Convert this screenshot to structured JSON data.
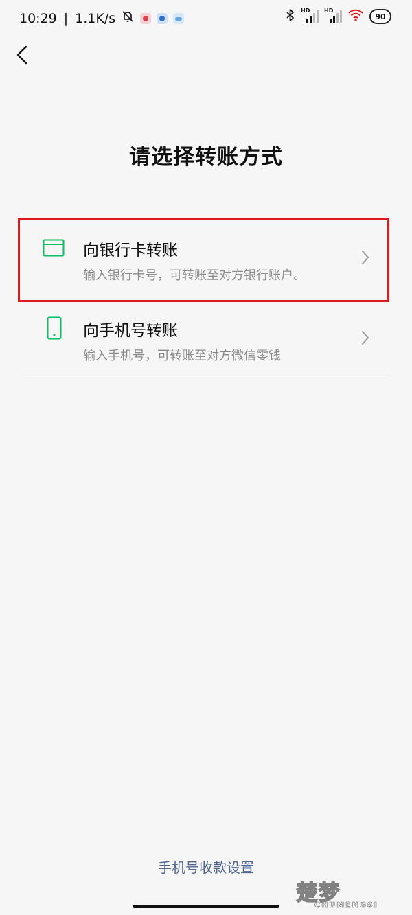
{
  "status_bar": {
    "time": "10:29",
    "separator": "|",
    "net_speed": "1.1K/s",
    "signal_label": "HD",
    "battery": "90"
  },
  "page": {
    "title": "请选择转账方式"
  },
  "options": [
    {
      "title": "向银行卡转账",
      "desc": "输入银行卡号，可转账至对方银行账户。"
    },
    {
      "title": "向手机号转账",
      "desc": "输入手机号，可转账至对方微信零钱"
    }
  ],
  "footer": {
    "link": "手机号收款设置"
  },
  "watermark": {
    "cn": "楚梦",
    "en": "CHUMENGSI"
  },
  "colors": {
    "accent_green": "#07c160",
    "link_blue": "#4f6690",
    "highlight_red": "#e0191f"
  }
}
